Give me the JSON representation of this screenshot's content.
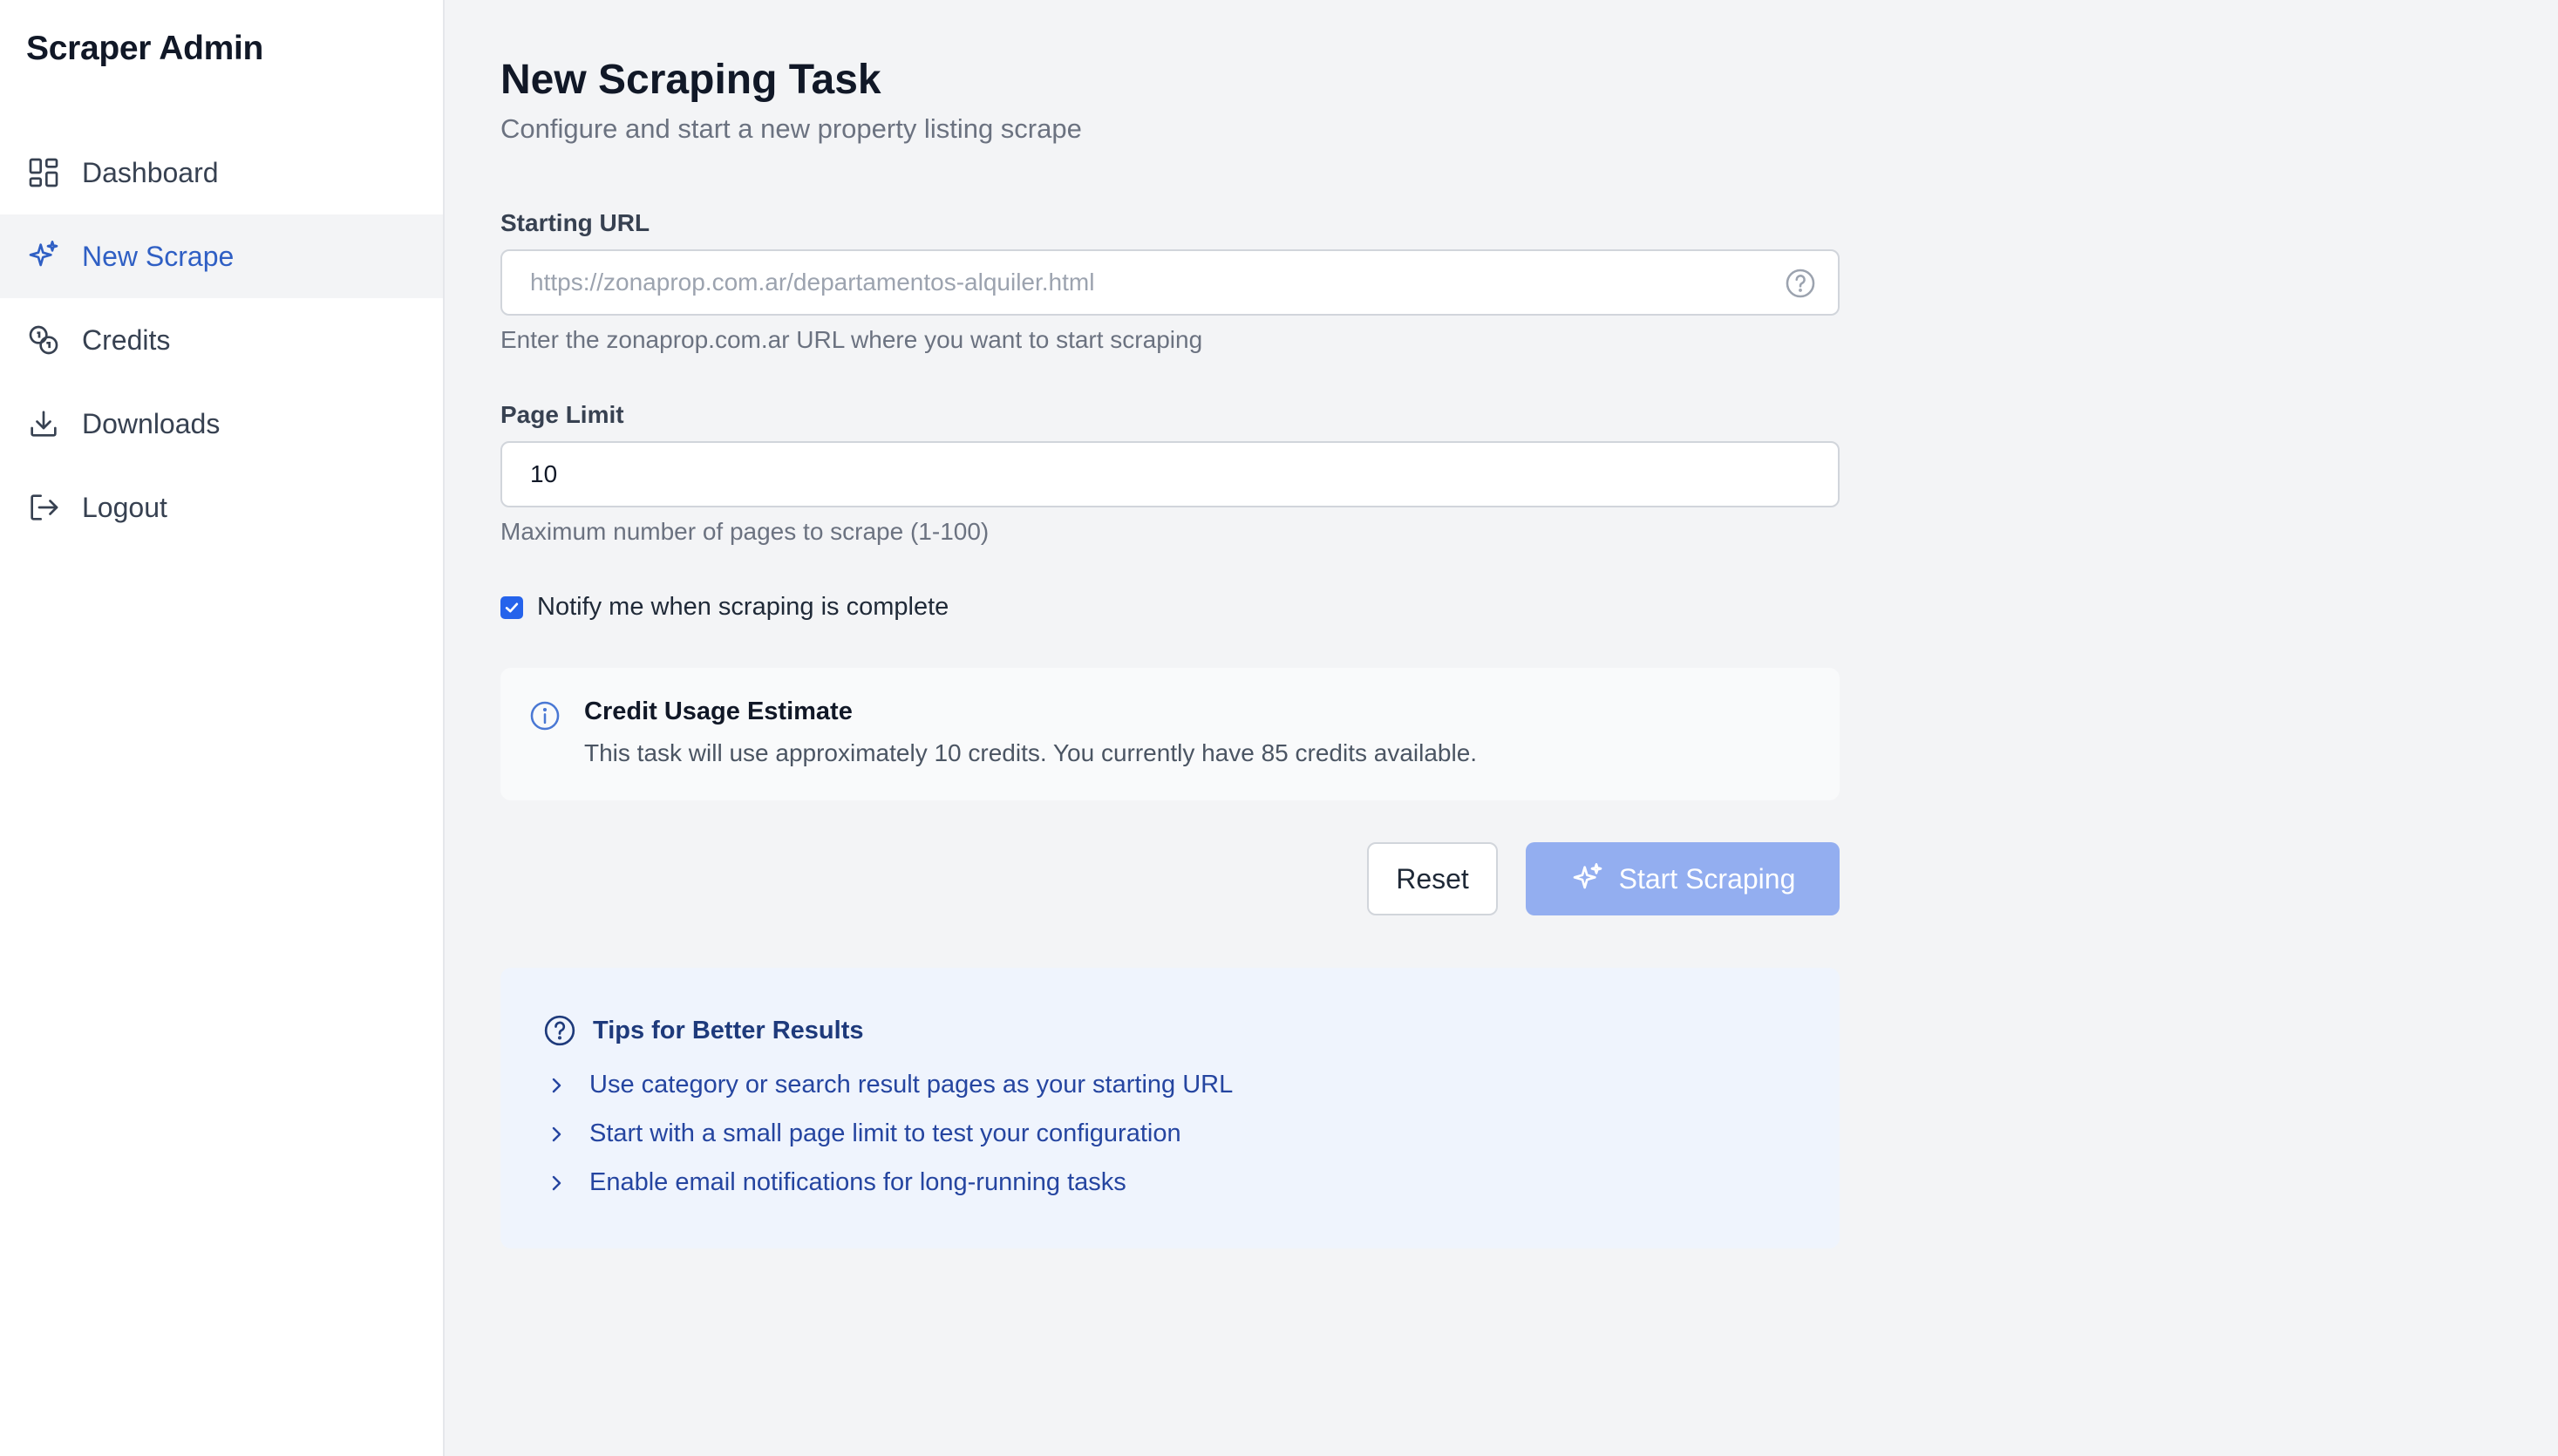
{
  "sidebar": {
    "brand": "Scraper Admin",
    "items": [
      {
        "label": "Dashboard",
        "icon": "dashboard-grid-icon",
        "active": false
      },
      {
        "label": "New Scrape",
        "icon": "sparkles-icon",
        "active": true
      },
      {
        "label": "Credits",
        "icon": "coins-icon",
        "active": false
      },
      {
        "label": "Downloads",
        "icon": "download-icon",
        "active": false
      },
      {
        "label": "Logout",
        "icon": "logout-icon",
        "active": false
      }
    ]
  },
  "page": {
    "title": "New Scraping Task",
    "subtitle": "Configure and start a new property listing scrape"
  },
  "form": {
    "url": {
      "label": "Starting URL",
      "placeholder": "https://zonaprop.com.ar/departamentos-alquiler.html",
      "value": "",
      "hint": "Enter the zonaprop.com.ar URL where you want to start scraping"
    },
    "page_limit": {
      "label": "Page Limit",
      "value": "10",
      "hint": "Maximum number of pages to scrape (1-100)"
    },
    "notify": {
      "label": "Notify me when scraping is complete",
      "checked": true
    }
  },
  "estimate": {
    "title": "Credit Usage Estimate",
    "text": "This task will use approximately 10 credits. You currently have 85 credits available."
  },
  "actions": {
    "reset_label": "Reset",
    "start_label": "Start Scraping"
  },
  "tips": {
    "title": "Tips for Better Results",
    "items": [
      "Use category or search result pages as your starting URL",
      "Start with a small page limit to test your configuration",
      "Enable email notifications for long-running tasks"
    ]
  },
  "colors": {
    "accent": "#2f5fc4",
    "checkbox": "#2563eb",
    "start_button_disabled": "#93aef0",
    "tips_bg": "#eff4fd",
    "tips_text": "#2545a0"
  }
}
